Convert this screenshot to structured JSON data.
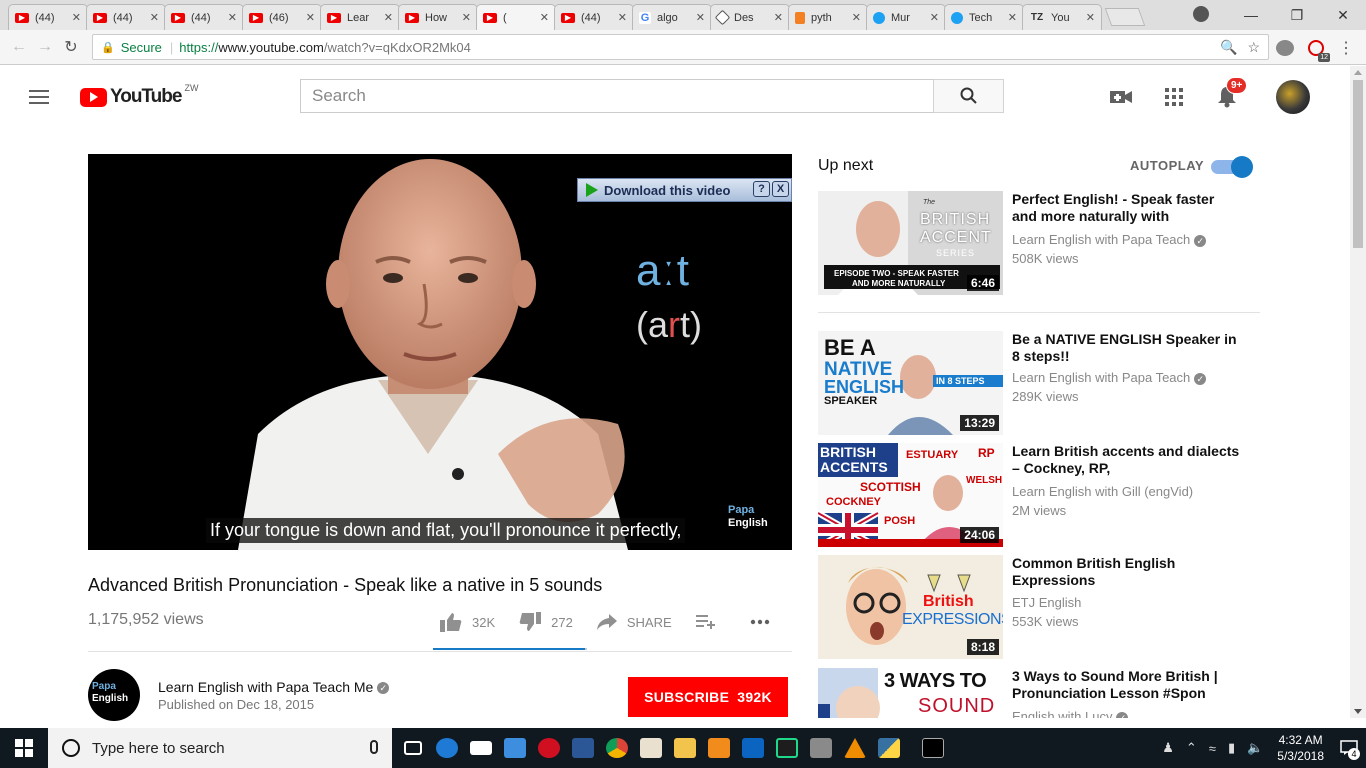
{
  "browser": {
    "tabs": [
      {
        "label": "(44)",
        "icon": "youtube-icon"
      },
      {
        "label": "(44)",
        "icon": "youtube-icon"
      },
      {
        "label": "(44)",
        "icon": "youtube-icon"
      },
      {
        "label": "(46)",
        "icon": "youtube-icon"
      },
      {
        "label": "Lear",
        "icon": "youtube-icon"
      },
      {
        "label": "How",
        "icon": "youtube-icon"
      },
      {
        "label": "(",
        "icon": "youtube-icon"
      },
      {
        "label": "(44)",
        "icon": "youtube-icon"
      },
      {
        "label": "algo",
        "icon": "google-icon"
      },
      {
        "label": "Des",
        "icon": "diamond-icon"
      },
      {
        "label": "pyth",
        "icon": "stackoverflow-icon"
      },
      {
        "label": "Mur",
        "icon": "twitter-icon"
      },
      {
        "label": "Tech",
        "icon": "twitter-icon"
      },
      {
        "label": "You",
        "icon": "tz-icon"
      }
    ],
    "active_tab_index": 6,
    "secure_label": "Secure",
    "url_scheme": "https://",
    "url_host": "www.youtube.com",
    "url_path": "/watch?v=qKdxOR2Mk04",
    "extension_badge": "12"
  },
  "youtube": {
    "logo_text": "YouTube",
    "country_code": "ZW",
    "search_placeholder": "Search",
    "notification_count": "9+"
  },
  "player": {
    "overlay_aart": "aːt",
    "overlay_art_open": "(a",
    "overlay_art_r": "r",
    "overlay_art_close": "t)",
    "watermark_line1": "Papa",
    "watermark_line2": "English",
    "caption": "If your tongue is down and flat, you'll pronounce it perfectly,",
    "download_label": "Download this video",
    "download_help": "?",
    "download_close": "X"
  },
  "video": {
    "title": "Advanced British Pronunciation - Speak like a native in 5 sounds",
    "views": "1,175,952 views",
    "likes": "32K",
    "dislikes": "272",
    "share_label": "SHARE",
    "like_fraction": 0.99
  },
  "channel": {
    "avatar_line1": "Papa",
    "avatar_line2": "English",
    "name": "Learn English with Papa Teach Me",
    "published": "Published on Dec 18, 2015",
    "subscribe_label": "SUBSCRIBE",
    "subscriber_count": "392K"
  },
  "sidebar": {
    "up_next_label": "Up next",
    "autoplay_label": "AUTOPLAY",
    "autoplay_on": true,
    "recommendations": [
      {
        "title": "Perfect English! - Speak faster and more naturally with",
        "channel": "Learn English with Papa Teach",
        "verified": true,
        "views": "508K views",
        "duration": "6:46",
        "thumb_text1": "The",
        "thumb_text2": "BRITISH",
        "thumb_text3": "ACCENT",
        "thumb_text4": "SERIES",
        "thumb_text5": "EPISODE TWO - SPEAK FASTER",
        "thumb_text6": "AND MORE NATURALLY"
      },
      {
        "title": "Be a NATIVE ENGLISH Speaker in 8 steps!!",
        "channel": "Learn English with Papa Teach",
        "verified": true,
        "views": "289K views",
        "duration": "13:29",
        "thumb_text1": "BE A",
        "thumb_text2": "NATIVE",
        "thumb_text3": "ENGLISH",
        "thumb_text4": "SPEAKER",
        "thumb_text5": "IN 8 STEPS"
      },
      {
        "title": "Learn British accents and dialects – Cockney, RP,",
        "channel": "Learn English with Gill (engVid)",
        "verified": false,
        "views": "2M views",
        "duration": "24:06",
        "thumb_text1": "BRITISH",
        "thumb_text2": "ACCENTS",
        "thumb_text3": "ESTUARY",
        "thumb_text4": "RP",
        "thumb_text5": "SCOTTISH",
        "thumb_text6": "WELSH",
        "thumb_text7": "COCKNEY",
        "thumb_text8": "POSH"
      },
      {
        "title": "Common British English Expressions",
        "channel": "ETJ English",
        "verified": false,
        "views": "553K views",
        "duration": "8:18",
        "thumb_text1": "British",
        "thumb_text2": "EXPRESSIONS"
      },
      {
        "title": "3 Ways to Sound More British | Pronunciation Lesson #Spon",
        "channel": "English with Lucy",
        "verified": true,
        "views": "",
        "duration": "",
        "thumb_text1": "3 WAYS TO",
        "thumb_text2": "SOUND"
      }
    ]
  },
  "taskbar": {
    "search_placeholder": "Type here to search",
    "time": "4:32 AM",
    "date": "5/3/2018",
    "notification_count": "4"
  }
}
